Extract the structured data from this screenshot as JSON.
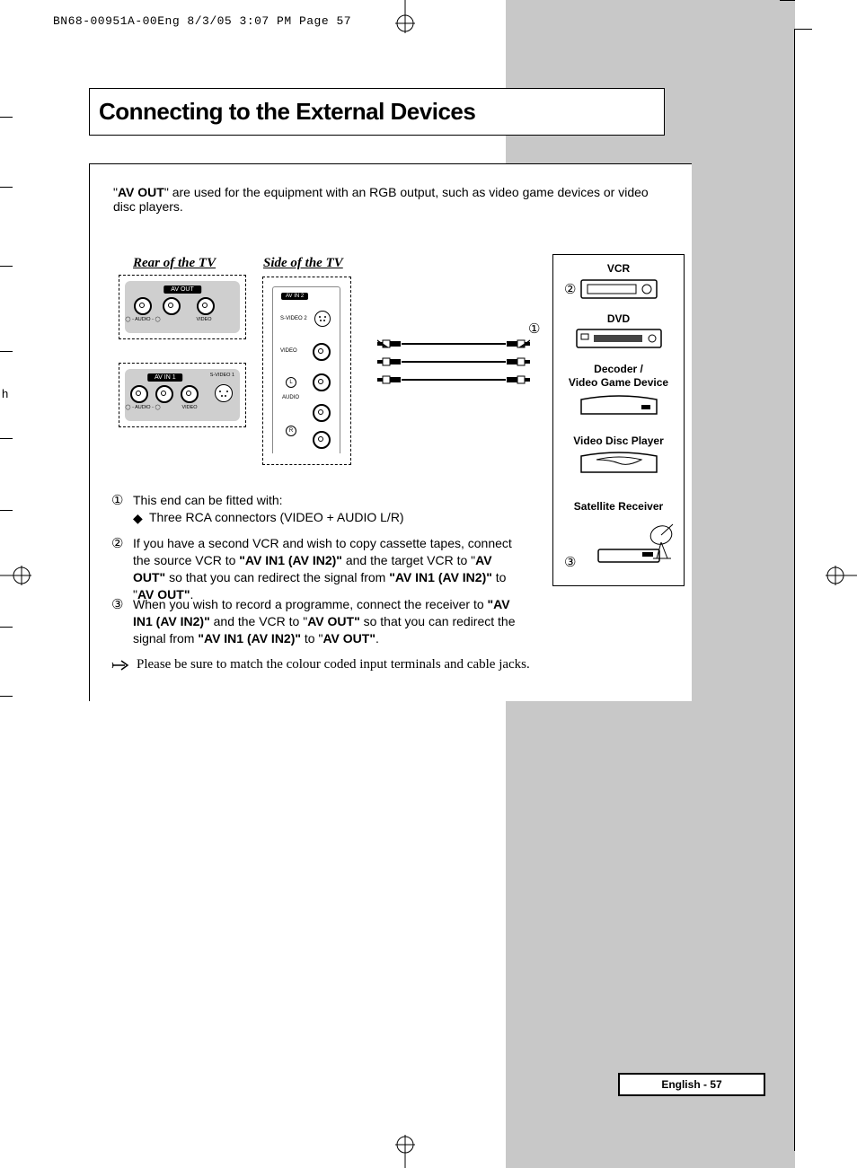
{
  "header": "BN68-00951A-00Eng  8/3/05  3:07 PM  Page 57",
  "title": "Connecting to the External Devices",
  "intro_prefix": "\"",
  "intro_bold": "AV OUT",
  "intro_suffix": "\" are used for the equipment with an RGB output, such as video game devices or video disc players.",
  "labels": {
    "rear": "Rear of the TV",
    "side": "Side of the TV"
  },
  "panels": {
    "avout_title": "AV OUT",
    "avin1_title": "AV IN 1",
    "svideo1": "S-VIDEO 1",
    "audio_label": "AUDIO",
    "video_label": "VIDEO",
    "avin2": "AV IN 2",
    "svideo2": "S-VIDEO 2",
    "audio_word": "AUDIO",
    "l": "L",
    "r": "R"
  },
  "markers": {
    "m1": "①",
    "m2": "②",
    "m3": "③"
  },
  "devices": {
    "vcr": "VCR",
    "dvd": "DVD",
    "decoder": "Decoder /",
    "decoder2": "Video Game Device",
    "vdp": "Video Disc Player",
    "sat": "Satellite Receiver"
  },
  "steps": {
    "s1_lead": "This end can be fitted with:",
    "s1_bullet": "Three RCA connectors (VIDEO + AUDIO L/R)",
    "s2_a": "If you have a second VCR and wish to copy cassette tapes, connect the source VCR to ",
    "s2_b1": "\"AV IN1 (AV IN2)\"",
    "s2_c": " and the target VCR to \"",
    "s2_b2": "AV OUT\"",
    "s2_d": " so that you can redirect the signal from ",
    "s2_b3": "\"AV IN1 (AV IN2)\"",
    "s2_e": " to \"",
    "s2_b4": "AV OUT\"",
    "s2_f": ".",
    "s3_a": "When you wish to record a programme, connect the receiver to ",
    "s3_b1": "\"AV IN1 (AV IN2)\"",
    "s3_c": " and the VCR to \"",
    "s3_b2": "AV OUT\"",
    "s3_d": " so that you can redirect the signal from ",
    "s3_b3": "\"AV IN1 (AV IN2)\"",
    "s3_e": " to \"",
    "s3_b4": "AV OUT\"",
    "s3_f": "."
  },
  "note": "Please be sure to match the colour coded input terminals and cable jacks.",
  "footer": "English - 57",
  "left_h": "h"
}
